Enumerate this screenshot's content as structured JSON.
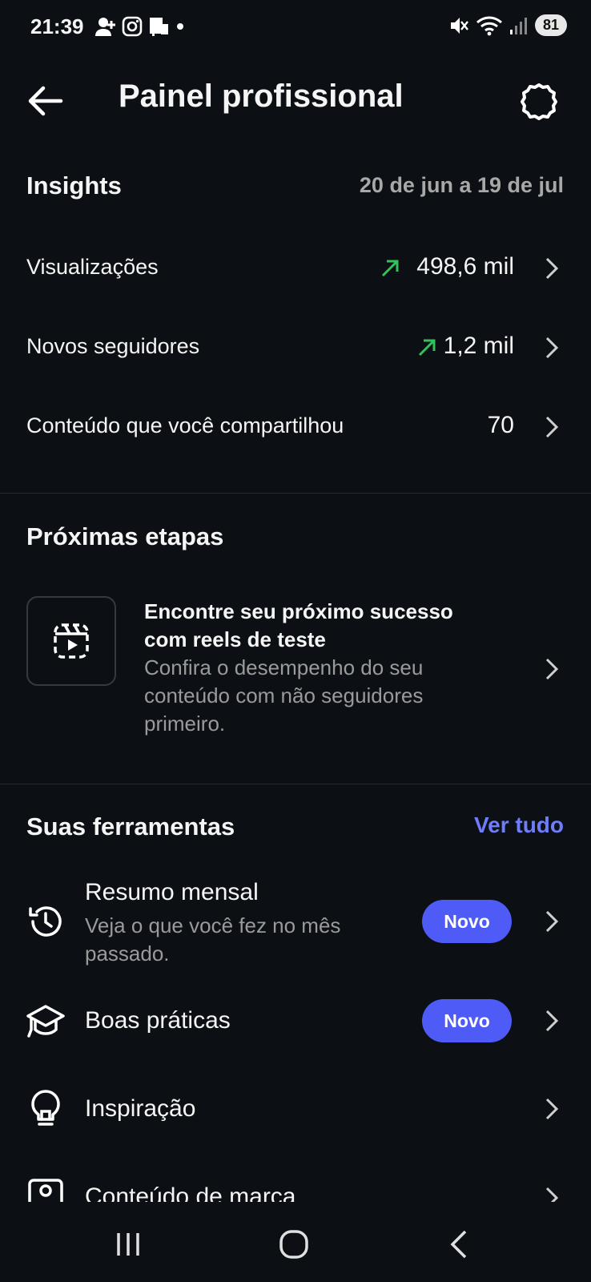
{
  "status": {
    "time": "21:39",
    "battery": "81"
  },
  "header": {
    "title": "Painel profissional"
  },
  "insights": {
    "title": "Insights",
    "date_range": "20 de jun a 19 de jul",
    "rows": [
      {
        "label": "Visualizações",
        "value": "498,6 mil",
        "trend": "up"
      },
      {
        "label": "Novos seguidores",
        "value": "1,2 mil",
        "trend": "up"
      },
      {
        "label": "Conteúdo que você compartilhou",
        "value": "70"
      }
    ],
    "trend_color": "#33c15a"
  },
  "next_steps": {
    "title": "Próximas etapas",
    "card": {
      "icon": "reels-dashed-icon",
      "title": "Encontre seu próximo sucesso com reels de teste",
      "description": "Confira o desempenho do seu conteúdo com não seguidores primeiro."
    }
  },
  "tools": {
    "title": "Suas ferramentas",
    "see_all": "Ver tudo",
    "items": [
      {
        "icon": "history-icon",
        "title": "Resumo mensal",
        "description": "Veja o que você fez no mês passado.",
        "badge": "Novo"
      },
      {
        "icon": "graduation-cap-icon",
        "title": "Boas práticas",
        "badge": "Novo"
      },
      {
        "icon": "lightbulb-icon",
        "title": "Inspiração"
      },
      {
        "icon": "branded-content-icon",
        "title": "Conteúdo de marca"
      }
    ]
  },
  "colors": {
    "background": "#0c1014",
    "accent": "#4f5bf6",
    "link": "#6f7dfa"
  }
}
